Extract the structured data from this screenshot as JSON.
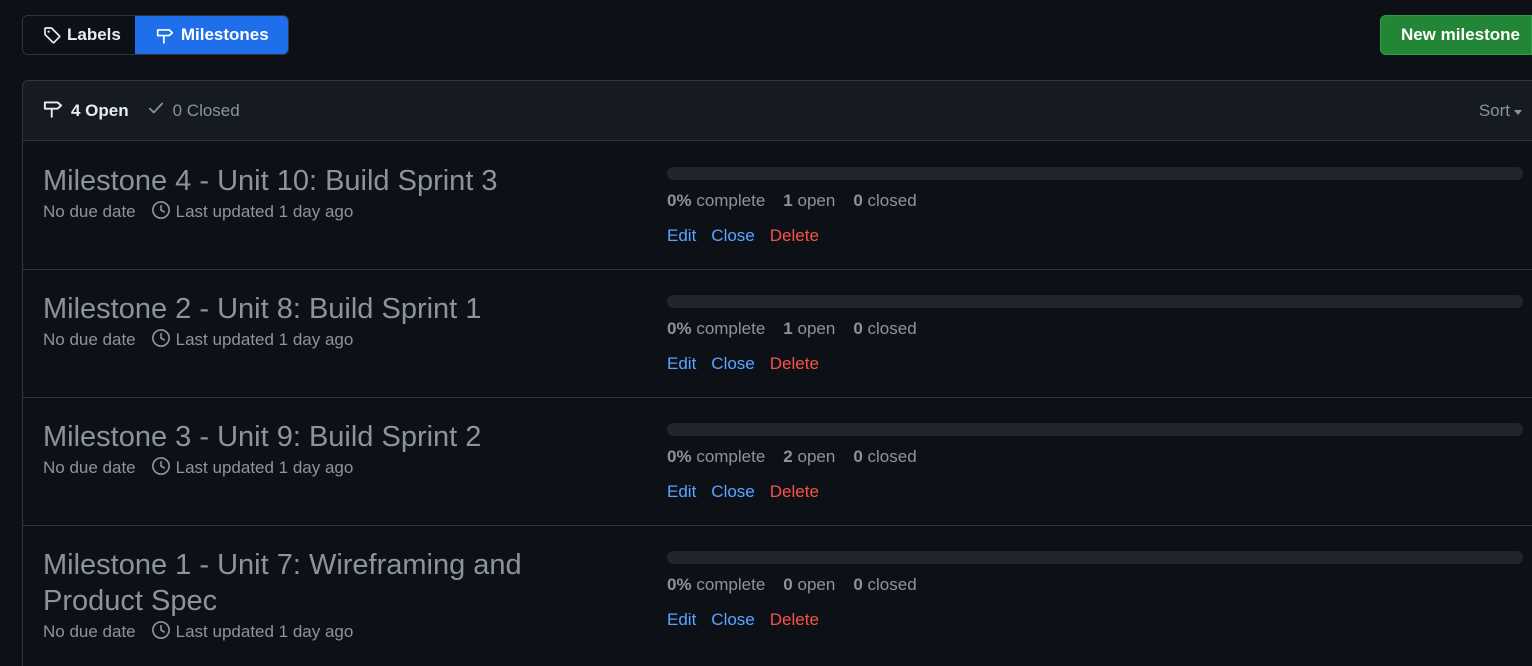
{
  "tabs": {
    "labels": "Labels",
    "milestones": "Milestones"
  },
  "new_milestone_label": "New milestone",
  "header": {
    "open_label": "4 Open",
    "closed_label": "0 Closed",
    "sort_label": "Sort"
  },
  "milestones": [
    {
      "title": "Milestone 4 - Unit 10: Build Sprint 3",
      "due": "No due date",
      "updated": "Last updated 1 day ago",
      "percent": "0%",
      "complete_word": "complete",
      "open_count": "1",
      "open_word": "open",
      "closed_count": "0",
      "closed_word": "closed",
      "progress": 0,
      "edit": "Edit",
      "close": "Close",
      "delete": "Delete"
    },
    {
      "title": "Milestone 2 - Unit 8: Build Sprint 1",
      "due": "No due date",
      "updated": "Last updated 1 day ago",
      "percent": "0%",
      "complete_word": "complete",
      "open_count": "1",
      "open_word": "open",
      "closed_count": "0",
      "closed_word": "closed",
      "progress": 0,
      "edit": "Edit",
      "close": "Close",
      "delete": "Delete"
    },
    {
      "title": "Milestone 3 - Unit 9: Build Sprint 2",
      "due": "No due date",
      "updated": "Last updated 1 day ago",
      "percent": "0%",
      "complete_word": "complete",
      "open_count": "2",
      "open_word": "open",
      "closed_count": "0",
      "closed_word": "closed",
      "progress": 0,
      "edit": "Edit",
      "close": "Close",
      "delete": "Delete"
    },
    {
      "title": "Milestone 1 - Unit 7: Wireframing and Product Spec",
      "due": "No due date",
      "updated": "Last updated 1 day ago",
      "percent": "0%",
      "complete_word": "complete",
      "open_count": "0",
      "open_word": "open",
      "closed_count": "0",
      "closed_word": "closed",
      "progress": 0,
      "edit": "Edit",
      "close": "Close",
      "delete": "Delete"
    }
  ],
  "colors": {
    "background": "#0d1117",
    "header_bg": "#161b22",
    "accent_blue": "#1f6feb",
    "link_blue": "#58a6ff",
    "danger_red": "#f85149",
    "success_green": "#238636"
  },
  "icons": {
    "labels": "tag-icon",
    "milestones": "milestone-icon",
    "closed": "check-icon",
    "updated": "clock-icon"
  }
}
